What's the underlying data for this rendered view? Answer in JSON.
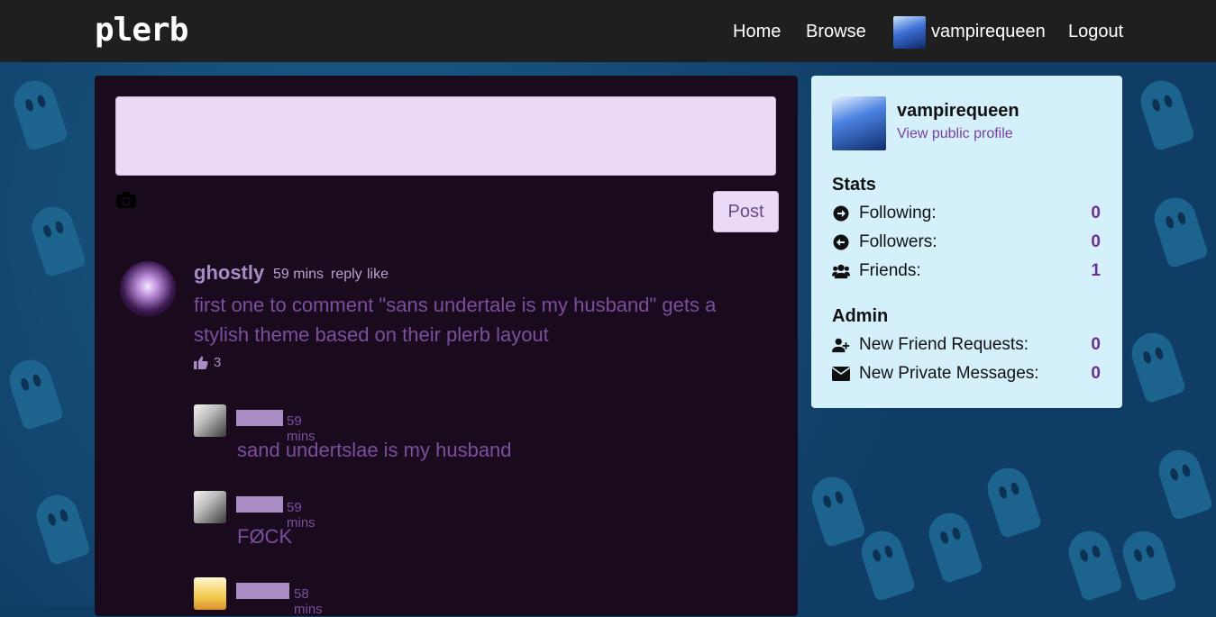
{
  "header": {
    "logo": "plerb",
    "nav": {
      "home": "Home",
      "browse": "Browse",
      "user": "vampirequeen",
      "logout": "Logout"
    }
  },
  "composer": {
    "value": "",
    "placeholder": "",
    "post_label": "Post"
  },
  "comment": {
    "author": "ghostly",
    "time": "59 mins",
    "reply_label": "reply",
    "like_label": "like",
    "text": "first one to comment \"sans undertale is my husband\" gets a stylish theme based on their plerb layout",
    "likes": "3"
  },
  "replies": [
    {
      "time": "59 mins",
      "text": "sand undertslae is my husband"
    },
    {
      "time": "59 mins",
      "text": "FØCK"
    },
    {
      "time": "58 mins",
      "text": ""
    }
  ],
  "sidebar": {
    "username": "vampirequeen",
    "profile_link": "View public profile",
    "stats_title": "Stats",
    "stats": [
      {
        "icon": "arrow-right-circle-icon",
        "label": "Following:",
        "value": "0"
      },
      {
        "icon": "arrow-left-circle-icon",
        "label": "Followers:",
        "value": "0"
      },
      {
        "icon": "users-icon",
        "label": "Friends:",
        "value": "1"
      }
    ],
    "admin_title": "Admin",
    "admin": [
      {
        "icon": "user-plus-icon",
        "label": "New Friend Requests:",
        "value": "0"
      },
      {
        "icon": "envelope-icon",
        "label": "New Private Messages:",
        "value": "0"
      }
    ]
  },
  "colors": {
    "topbar": "#1f1f1f",
    "feed_bg": "#1a0a1e",
    "sidebar_bg": "#d4f0fb",
    "accent_purple": "#7b4f9c",
    "count_purple": "#6a2f91",
    "wallpaper": "#0f3d66"
  }
}
